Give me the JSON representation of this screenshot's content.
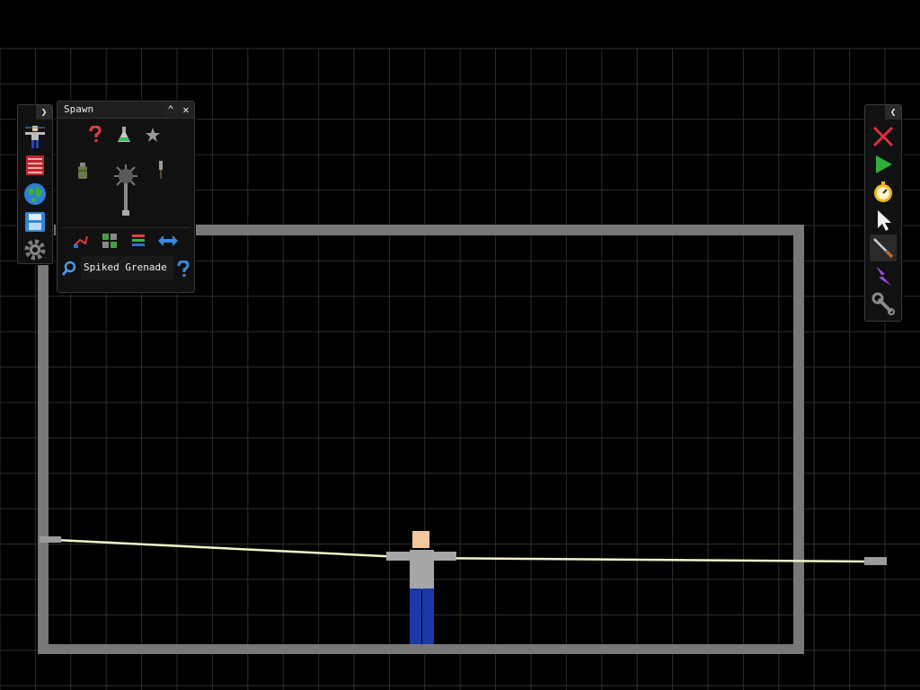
{
  "spawn_menu": {
    "title": "Spawn",
    "search": {
      "value": "Spiked Grenade"
    },
    "items": [
      "mystery-spawn-icon",
      "flask-icon",
      "star-icon",
      "grenade-icon",
      "spiked-grenade-icon",
      "knife-icon"
    ],
    "footer_tools": [
      "wire-tool-icon",
      "grid-tool-icon",
      "layers-tool-icon",
      "flip-tool-icon"
    ]
  },
  "left_toolbar": {
    "items": [
      "human-icon",
      "book-icon",
      "globe-icon",
      "save-icon",
      "settings-icon"
    ]
  },
  "right_toolbar": {
    "items": [
      "delete-icon",
      "play-icon",
      "timer-icon",
      "cursor-icon",
      "knife-tool-icon",
      "lightning-icon",
      "wrench-icon"
    ]
  },
  "colors": {
    "background": "#000000",
    "grid": "#5a5a5a",
    "arena": "#7a7a7a",
    "rope": "#f3f3c8",
    "skin": "#f2c59a",
    "shirt": "#a6a6a6",
    "pants": "#1c38a8"
  }
}
